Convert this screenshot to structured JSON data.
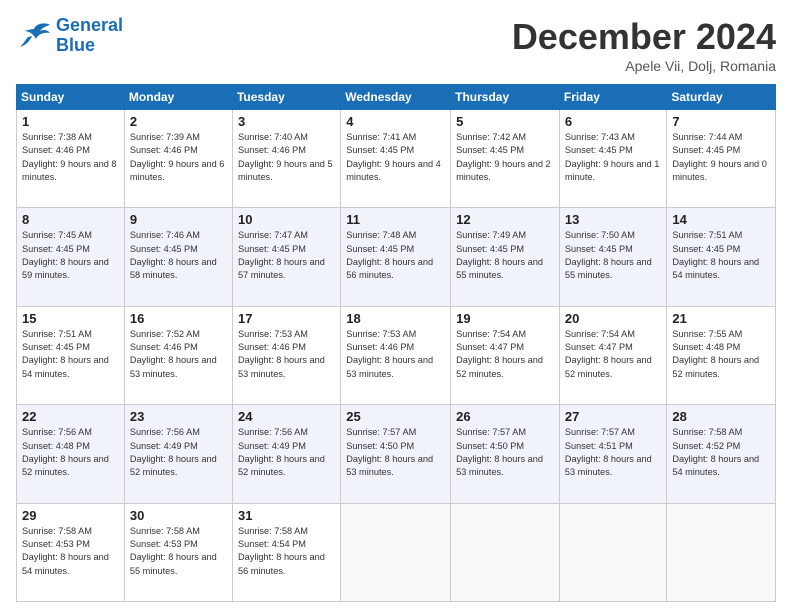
{
  "logo": {
    "line1": "General",
    "line2": "Blue"
  },
  "header": {
    "month": "December 2024",
    "location": "Apele Vii, Dolj, Romania"
  },
  "weekdays": [
    "Sunday",
    "Monday",
    "Tuesday",
    "Wednesday",
    "Thursday",
    "Friday",
    "Saturday"
  ],
  "weeks": [
    [
      {
        "day": "1",
        "sunrise": "7:38 AM",
        "sunset": "4:46 PM",
        "daylight": "9 hours and 8 minutes."
      },
      {
        "day": "2",
        "sunrise": "7:39 AM",
        "sunset": "4:46 PM",
        "daylight": "9 hours and 6 minutes."
      },
      {
        "day": "3",
        "sunrise": "7:40 AM",
        "sunset": "4:46 PM",
        "daylight": "9 hours and 5 minutes."
      },
      {
        "day": "4",
        "sunrise": "7:41 AM",
        "sunset": "4:45 PM",
        "daylight": "9 hours and 4 minutes."
      },
      {
        "day": "5",
        "sunrise": "7:42 AM",
        "sunset": "4:45 PM",
        "daylight": "9 hours and 2 minutes."
      },
      {
        "day": "6",
        "sunrise": "7:43 AM",
        "sunset": "4:45 PM",
        "daylight": "9 hours and 1 minute."
      },
      {
        "day": "7",
        "sunrise": "7:44 AM",
        "sunset": "4:45 PM",
        "daylight": "9 hours and 0 minutes."
      }
    ],
    [
      {
        "day": "8",
        "sunrise": "7:45 AM",
        "sunset": "4:45 PM",
        "daylight": "8 hours and 59 minutes."
      },
      {
        "day": "9",
        "sunrise": "7:46 AM",
        "sunset": "4:45 PM",
        "daylight": "8 hours and 58 minutes."
      },
      {
        "day": "10",
        "sunrise": "7:47 AM",
        "sunset": "4:45 PM",
        "daylight": "8 hours and 57 minutes."
      },
      {
        "day": "11",
        "sunrise": "7:48 AM",
        "sunset": "4:45 PM",
        "daylight": "8 hours and 56 minutes."
      },
      {
        "day": "12",
        "sunrise": "7:49 AM",
        "sunset": "4:45 PM",
        "daylight": "8 hours and 55 minutes."
      },
      {
        "day": "13",
        "sunrise": "7:50 AM",
        "sunset": "4:45 PM",
        "daylight": "8 hours and 55 minutes."
      },
      {
        "day": "14",
        "sunrise": "7:51 AM",
        "sunset": "4:45 PM",
        "daylight": "8 hours and 54 minutes."
      }
    ],
    [
      {
        "day": "15",
        "sunrise": "7:51 AM",
        "sunset": "4:45 PM",
        "daylight": "8 hours and 54 minutes."
      },
      {
        "day": "16",
        "sunrise": "7:52 AM",
        "sunset": "4:46 PM",
        "daylight": "8 hours and 53 minutes."
      },
      {
        "day": "17",
        "sunrise": "7:53 AM",
        "sunset": "4:46 PM",
        "daylight": "8 hours and 53 minutes."
      },
      {
        "day": "18",
        "sunrise": "7:53 AM",
        "sunset": "4:46 PM",
        "daylight": "8 hours and 53 minutes."
      },
      {
        "day": "19",
        "sunrise": "7:54 AM",
        "sunset": "4:47 PM",
        "daylight": "8 hours and 52 minutes."
      },
      {
        "day": "20",
        "sunrise": "7:54 AM",
        "sunset": "4:47 PM",
        "daylight": "8 hours and 52 minutes."
      },
      {
        "day": "21",
        "sunrise": "7:55 AM",
        "sunset": "4:48 PM",
        "daylight": "8 hours and 52 minutes."
      }
    ],
    [
      {
        "day": "22",
        "sunrise": "7:56 AM",
        "sunset": "4:48 PM",
        "daylight": "8 hours and 52 minutes."
      },
      {
        "day": "23",
        "sunrise": "7:56 AM",
        "sunset": "4:49 PM",
        "daylight": "8 hours and 52 minutes."
      },
      {
        "day": "24",
        "sunrise": "7:56 AM",
        "sunset": "4:49 PM",
        "daylight": "8 hours and 52 minutes."
      },
      {
        "day": "25",
        "sunrise": "7:57 AM",
        "sunset": "4:50 PM",
        "daylight": "8 hours and 53 minutes."
      },
      {
        "day": "26",
        "sunrise": "7:57 AM",
        "sunset": "4:50 PM",
        "daylight": "8 hours and 53 minutes."
      },
      {
        "day": "27",
        "sunrise": "7:57 AM",
        "sunset": "4:51 PM",
        "daylight": "8 hours and 53 minutes."
      },
      {
        "day": "28",
        "sunrise": "7:58 AM",
        "sunset": "4:52 PM",
        "daylight": "8 hours and 54 minutes."
      }
    ],
    [
      {
        "day": "29",
        "sunrise": "7:58 AM",
        "sunset": "4:53 PM",
        "daylight": "8 hours and 54 minutes."
      },
      {
        "day": "30",
        "sunrise": "7:58 AM",
        "sunset": "4:53 PM",
        "daylight": "8 hours and 55 minutes."
      },
      {
        "day": "31",
        "sunrise": "7:58 AM",
        "sunset": "4:54 PM",
        "daylight": "8 hours and 56 minutes."
      },
      null,
      null,
      null,
      null
    ]
  ]
}
